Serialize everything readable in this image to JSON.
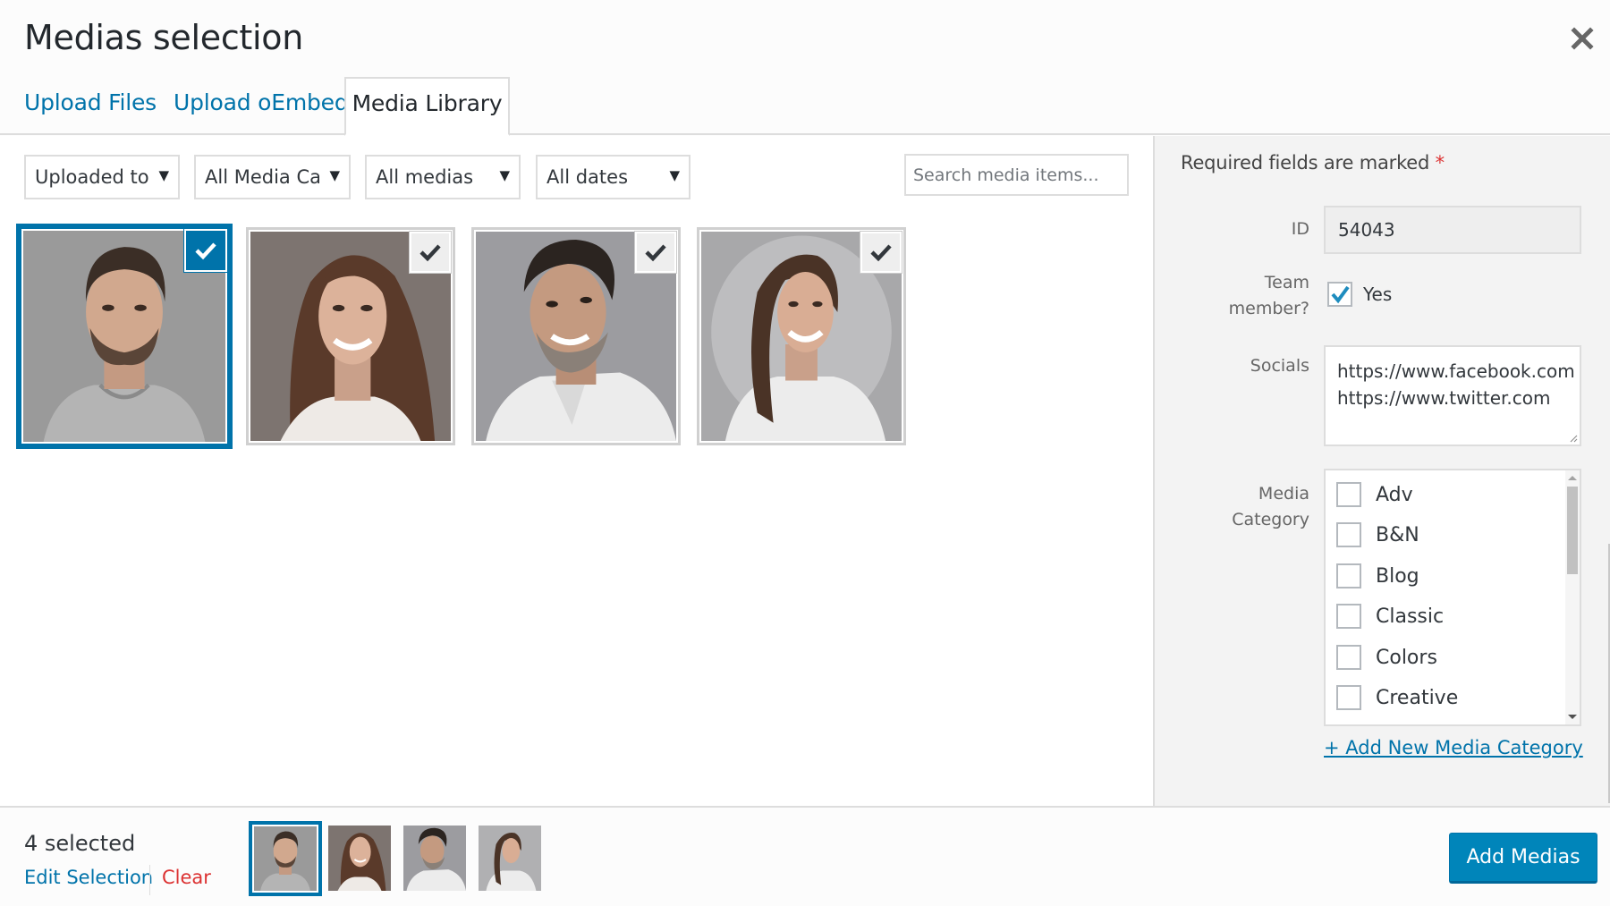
{
  "header": {
    "title": "Medias selection",
    "close_icon": "close-icon",
    "tabs": [
      {
        "label": "Upload Files",
        "active": false
      },
      {
        "label": "Upload oEmbed",
        "active": false
      },
      {
        "label": "Media Library",
        "active": true
      }
    ]
  },
  "filters": [
    {
      "label": "Uploaded to this post",
      "display": "Uploaded to t"
    },
    {
      "label": "All Media Categories",
      "display": "All Media Cat"
    },
    {
      "label": "All medias",
      "display": "All medias"
    },
    {
      "label": "All dates",
      "display": "All dates"
    }
  ],
  "search": {
    "placeholder": "Search media items...",
    "value": ""
  },
  "media_items": [
    {
      "description": "Portrait of bearded man in grey t-shirt",
      "selected": true,
      "focused": true
    },
    {
      "description": "Portrait of smiling woman with long brown hair",
      "selected": true,
      "focused": false
    },
    {
      "description": "Portrait of smiling man with grey beard in white shirt",
      "selected": true,
      "focused": false
    },
    {
      "description": "Portrait of smiling woman with curly hair in white t-shirt",
      "selected": true,
      "focused": false
    }
  ],
  "sidebar": {
    "required_note": "Required fields are marked",
    "required_star": "*",
    "id_label": "ID",
    "id_value": "54043",
    "team_member_label_line1": "Team",
    "team_member_label_line2": "member?",
    "team_member_checked": true,
    "team_member_option": "Yes",
    "socials_label": "Socials",
    "socials_value_lines": [
      "https://www.facebook.com",
      "https://www.twitter.com"
    ],
    "media_category_label_line1": "Media",
    "media_category_label_line2": "Category",
    "categories": [
      {
        "label": "Adv",
        "checked": false
      },
      {
        "label": "B&N",
        "checked": false
      },
      {
        "label": "Blog",
        "checked": false
      },
      {
        "label": "Classic",
        "checked": false
      },
      {
        "label": "Colors",
        "checked": false
      },
      {
        "label": "Creative",
        "checked": false
      }
    ],
    "add_category_link": "+ Add New Media Category"
  },
  "footer": {
    "selected_count": "4 selected",
    "edit_selection": "Edit Selection",
    "clear": "Clear",
    "add_button": "Add Medias"
  },
  "colors": {
    "accent": "#0073aa",
    "primary_button": "#0085ba",
    "danger": "#dc3232",
    "sidebar_bg": "#f3f3f3"
  }
}
